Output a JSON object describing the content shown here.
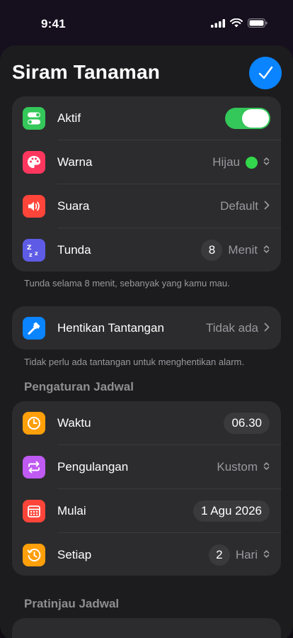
{
  "status_bar": {
    "time": "9:41"
  },
  "sheet": {
    "title": "Siram Tanaman"
  },
  "main_group": {
    "rows": [
      {
        "label": "Aktif",
        "toggle_on": true
      },
      {
        "label": "Warna",
        "value": "Hijau"
      },
      {
        "label": "Suara",
        "value": "Default"
      },
      {
        "label": "Tunda",
        "number": "8",
        "unit": "Menit"
      }
    ],
    "footnote": "Tunda selama 8 menit, sebanyak yang kamu mau."
  },
  "challenge_group": {
    "label": "Hentikan Tantangan",
    "value": "Tidak ada",
    "footnote": "Tidak perlu ada tantangan untuk menghentikan alarm."
  },
  "schedule_section": {
    "header": "Pengaturan Jadwal",
    "rows": [
      {
        "label": "Waktu",
        "value": "06.30"
      },
      {
        "label": "Pengulangan",
        "value": "Kustom"
      },
      {
        "label": "Mulai",
        "value": "1 Agu 2026"
      },
      {
        "label": "Setiap",
        "number": "2",
        "unit": "Hari"
      }
    ]
  },
  "preview_section": {
    "header": "Pratinjau Jadwal"
  },
  "colors": {
    "accent": "#0a84ff",
    "toggle_on": "#34c759",
    "icon_aktif": "#34c759",
    "icon_warna": "#ff375f",
    "icon_suara": "#ff453a",
    "icon_tunda": "#5e5ce6",
    "icon_tantangan": "#0a84ff",
    "icon_waktu": "#ff9f0a",
    "icon_pengulangan": "#bf5af2",
    "icon_mulai": "#ff453a",
    "icon_setiap": "#ff9f0a"
  }
}
